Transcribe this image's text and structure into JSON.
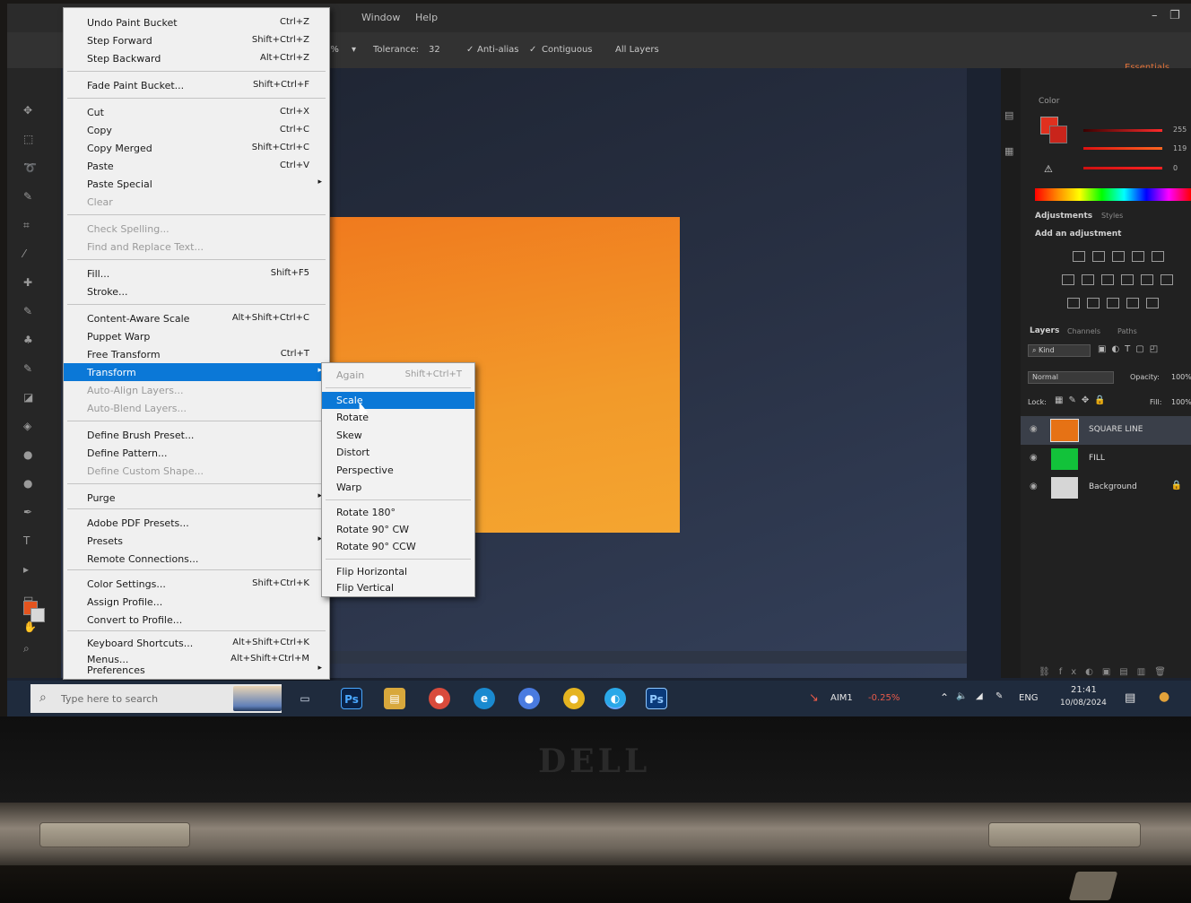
{
  "edit_menu": {
    "items": [
      {
        "label": "Undo Paint Bucket",
        "shortcut": "Ctrl+Z"
      },
      {
        "label": "Step Forward",
        "shortcut": "Shift+Ctrl+Z"
      },
      {
        "label": "Step Backward",
        "shortcut": "Alt+Ctrl+Z"
      },
      {
        "label": "Fade Paint Bucket...",
        "shortcut": "Shift+Ctrl+F"
      },
      {
        "label": "Cut",
        "shortcut": "Ctrl+X"
      },
      {
        "label": "Copy",
        "shortcut": "Ctrl+C"
      },
      {
        "label": "Copy Merged",
        "shortcut": "Shift+Ctrl+C"
      },
      {
        "label": "Paste",
        "shortcut": "Ctrl+V"
      },
      {
        "label": "Paste Special",
        "shortcut": ""
      },
      {
        "label": "Clear",
        "shortcut": ""
      },
      {
        "label": "Check Spelling...",
        "shortcut": ""
      },
      {
        "label": "Find and Replace Text...",
        "shortcut": ""
      },
      {
        "label": "Fill...",
        "shortcut": "Shift+F5"
      },
      {
        "label": "Stroke...",
        "shortcut": ""
      },
      {
        "label": "Content-Aware Scale",
        "shortcut": "Alt+Shift+Ctrl+C"
      },
      {
        "label": "Puppet Warp",
        "shortcut": ""
      },
      {
        "label": "Free Transform",
        "shortcut": "Ctrl+T"
      },
      {
        "label": "Transform",
        "shortcut": ""
      },
      {
        "label": "Auto-Align Layers...",
        "shortcut": ""
      },
      {
        "label": "Auto-Blend Layers...",
        "shortcut": ""
      },
      {
        "label": "Define Brush Preset...",
        "shortcut": ""
      },
      {
        "label": "Define Pattern...",
        "shortcut": ""
      },
      {
        "label": "Define Custom Shape...",
        "shortcut": ""
      },
      {
        "label": "Purge",
        "shortcut": ""
      },
      {
        "label": "Adobe PDF Presets...",
        "shortcut": ""
      },
      {
        "label": "Presets",
        "shortcut": ""
      },
      {
        "label": "Remote Connections...",
        "shortcut": ""
      },
      {
        "label": "Color Settings...",
        "shortcut": "Shift+Ctrl+K"
      },
      {
        "label": "Assign Profile...",
        "shortcut": ""
      },
      {
        "label": "Convert to Profile...",
        "shortcut": ""
      },
      {
        "label": "Keyboard Shortcuts...",
        "shortcut": "Alt+Shift+Ctrl+K"
      },
      {
        "label": "Menus...",
        "shortcut": "Alt+Shift+Ctrl+M"
      },
      {
        "label": "Preferences",
        "shortcut": ""
      }
    ]
  },
  "transform_menu": {
    "items": [
      {
        "label": "Again",
        "shortcut": "Shift+Ctrl+T"
      },
      {
        "label": "Scale",
        "shortcut": ""
      },
      {
        "label": "Rotate",
        "shortcut": ""
      },
      {
        "label": "Skew",
        "shortcut": ""
      },
      {
        "label": "Distort",
        "shortcut": ""
      },
      {
        "label": "Perspective",
        "shortcut": ""
      },
      {
        "label": "Warp",
        "shortcut": ""
      },
      {
        "label": "Rotate 180°",
        "shortcut": ""
      },
      {
        "label": "Rotate 90° CW",
        "shortcut": ""
      },
      {
        "label": "Rotate 90° CCW",
        "shortcut": ""
      },
      {
        "label": "Flip Horizontal",
        "shortcut": ""
      },
      {
        "label": "Flip Vertical",
        "shortcut": ""
      }
    ]
  },
  "menubar": {
    "window": "Window",
    "help": "Help"
  },
  "options_bar": {
    "opacity": "0%",
    "tolerance_label": "Tolerance:",
    "tolerance_value": "32",
    "anti_alias": "Anti-alias",
    "contiguous": "Contiguous",
    "all_layers": "All Layers",
    "workspace": "Essentials"
  },
  "color_panel": {
    "title": "Color",
    "r": "255",
    "g": "119",
    "b": "0"
  },
  "adjustments_panel": {
    "title": "Adjustments",
    "tab2": "Styles",
    "subtitle": "Add an adjustment"
  },
  "layers_panel": {
    "tab_layers": "Layers",
    "tab_channels": "Channels",
    "tab_paths": "Paths",
    "kind": "Kind",
    "blend_mode": "Normal",
    "opacity_label": "Opacity:",
    "opacity_value": "100%",
    "lock_label": "Lock:",
    "fill_label": "Fill:",
    "fill_value": "100%",
    "layers": [
      {
        "name": "SQUARE LINE",
        "color": "#e67215"
      },
      {
        "name": "FILL",
        "color": "#12c23a"
      },
      {
        "name": "Background",
        "color": "#d6d6d6"
      }
    ]
  },
  "taskbar": {
    "search_placeholder": "Type here to search",
    "apps": [
      {
        "name": "task-view-icon",
        "glyph": "▭",
        "color": "#1f2b3d"
      },
      {
        "name": "photoshop-icon",
        "glyph": "Ps",
        "color": "#0a2246"
      },
      {
        "name": "file-explorer-icon",
        "glyph": "▤",
        "color": "#d8a83c"
      },
      {
        "name": "chrome-icon",
        "glyph": "●",
        "color": "#d94b3c"
      },
      {
        "name": "edge-icon",
        "glyph": "e",
        "color": "#1a8ad0"
      },
      {
        "name": "photos-icon",
        "glyph": "●",
        "color": "#4a7be0"
      },
      {
        "name": "chrome-alt-icon",
        "glyph": "●",
        "color": "#e5b420"
      },
      {
        "name": "app-blue-icon",
        "glyph": "◐",
        "color": "#2aa8e8"
      },
      {
        "name": "photoshop-active-icon",
        "glyph": "Ps",
        "color": "#0a3a7a"
      }
    ],
    "stock_ticker": "AIM1",
    "stock_change": "-0.25%",
    "language": "ENG",
    "time": "21:41",
    "date": "10/08/2024"
  },
  "brand": "DELL"
}
